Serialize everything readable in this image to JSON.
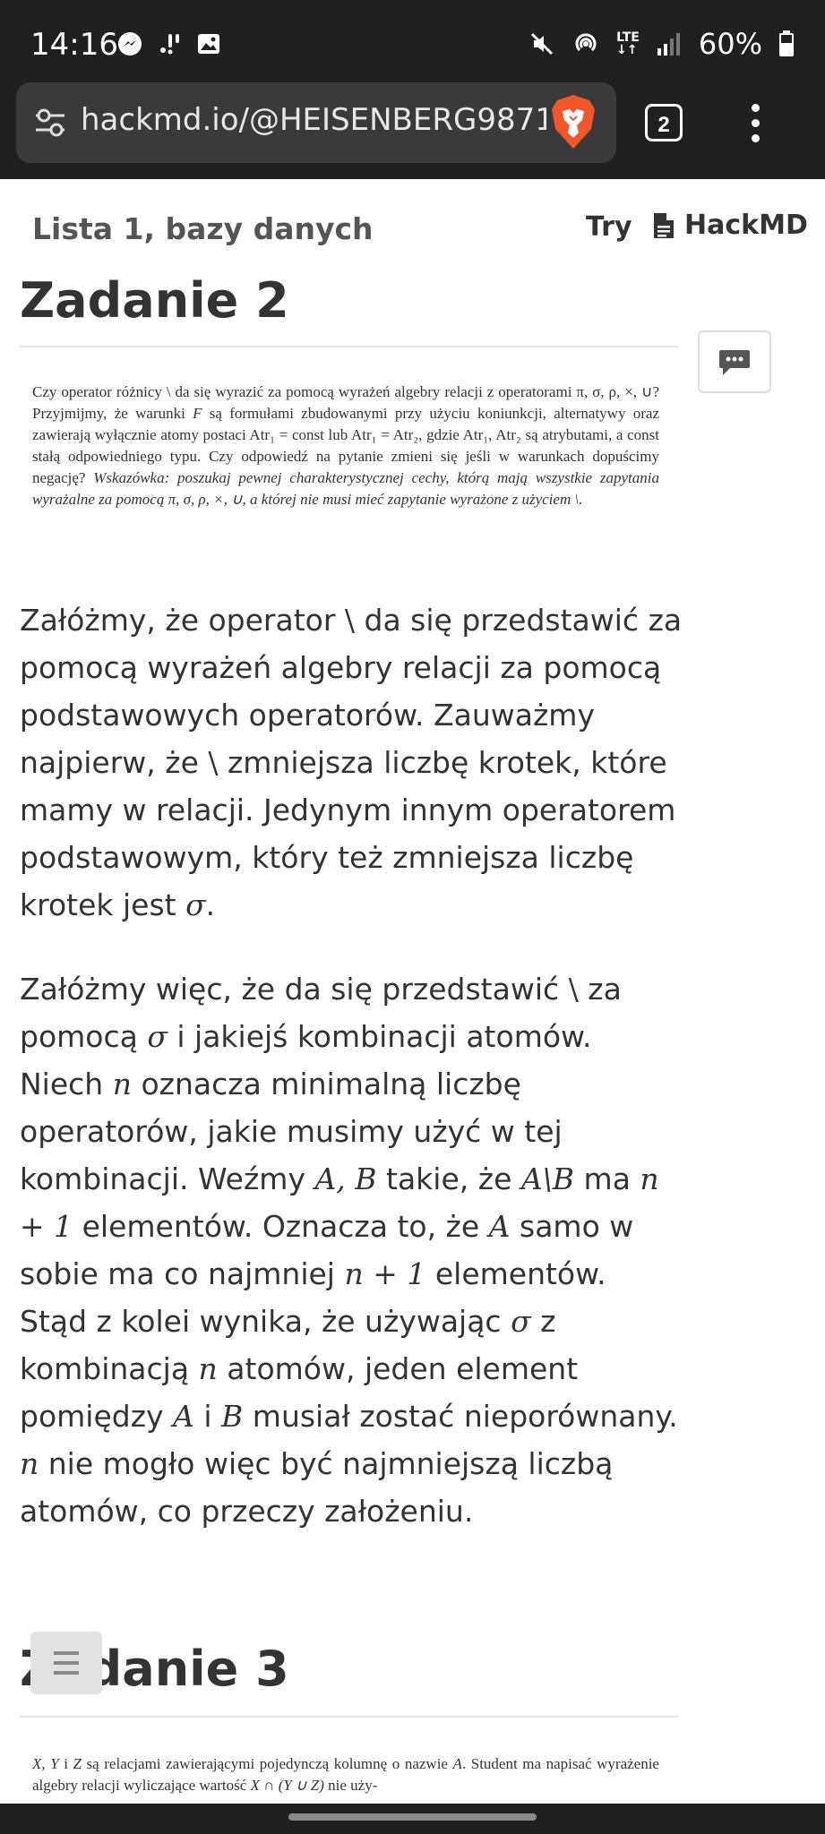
{
  "status_bar": {
    "time": "14:16",
    "network": "LTE",
    "battery": "60%",
    "icons": [
      "messenger-icon",
      "notification-icon",
      "gallery-icon",
      "mute-icon",
      "hotspot-icon",
      "lte-icon",
      "signal-icon",
      "battery-icon"
    ]
  },
  "browser": {
    "url": "hackmd.io/@HEISENBERG9871",
    "tab_count": "2",
    "brand_color": "#f1572a"
  },
  "header": {
    "doc_title": "Lista 1, bazy danych",
    "try_label": "Try",
    "hackmd_label": "HackMD"
  },
  "sections": [
    {
      "heading": "Zadanie 2",
      "scan_parts": [
        "Czy operator różnicy \\ da się wyrazić za pomocą wyrażeń algebry relacji z operatorami π, σ, ρ, ×, ∪? Przyjmijmy, że warunki ",
        "F",
        " są formułami zbudowanymi przy użyciu koniunkcji, alternatywy oraz zawierają wyłącznie atomy postaci Atr₁ = const lub Atr₁ = Atr₂, gdzie Atr₁, Atr₂ są atrybutami, a const stałą odpowiedniego typu. Czy odpowiedź na pytanie zmieni się jeśli w warunkach dopuścimy negację? ",
        "Wskazówka: poszukaj pewnej charakterystycznej cechy, którą mają wszystkie zapytania wyrażalne za pomocą π, σ, ρ, ×, ∪, a której nie musi mieć zapytanie wyrażone z użyciem \\."
      ]
    },
    {
      "heading": "Zadanie 3",
      "scan_parts": [
        "X, Y",
        " i ",
        "Z",
        " są relacjami zawierającymi pojedynczą kolumnę o nazwie ",
        "A",
        ". Student ma napisać wyrażenie algebry relacji wyliczające wartość ",
        "X ∩ (Y ∪ Z)",
        " nie uży-"
      ]
    }
  ],
  "paragraph1": [
    "Załóżmy, że operator ",
    "\\",
    " da się przedstawić za pomocą wyrażeń algebry relacji za pomocą podstawowych operatorów. Zauważmy najpierw, że ",
    "\\",
    " zmniejsza liczbę krotek, które mamy w relacji. Jedynym innym operatorem podstawowym, który też zmniejsza liczbę krotek jest ",
    "σ",
    "."
  ],
  "paragraph2": [
    "Załóżmy więc, że da się przedstawić ",
    "\\",
    " za pomocą ",
    "σ",
    " i jakiejś kombinacji atomów. Niech ",
    "n",
    " oznacza minimalną liczbę operatorów, jakie musimy użyć w tej kombinacji. Weźmy ",
    "A, B",
    " takie, że ",
    "A\\B",
    " ma ",
    "n + 1",
    " elementów. Oznacza to, że ",
    "A",
    " samo w sobie ma co najmniej ",
    "n + 1",
    " elementów. Stąd z kolei wynika, że używając ",
    "σ",
    " z kombinacją ",
    "n",
    " atomów, jeden element pomiędzy ",
    "A",
    " i ",
    "B",
    " musiał zostać nieporównany. ",
    "n",
    " nie mogło więc być najmniejszą liczbą atomów, co przeczy założeniu."
  ]
}
